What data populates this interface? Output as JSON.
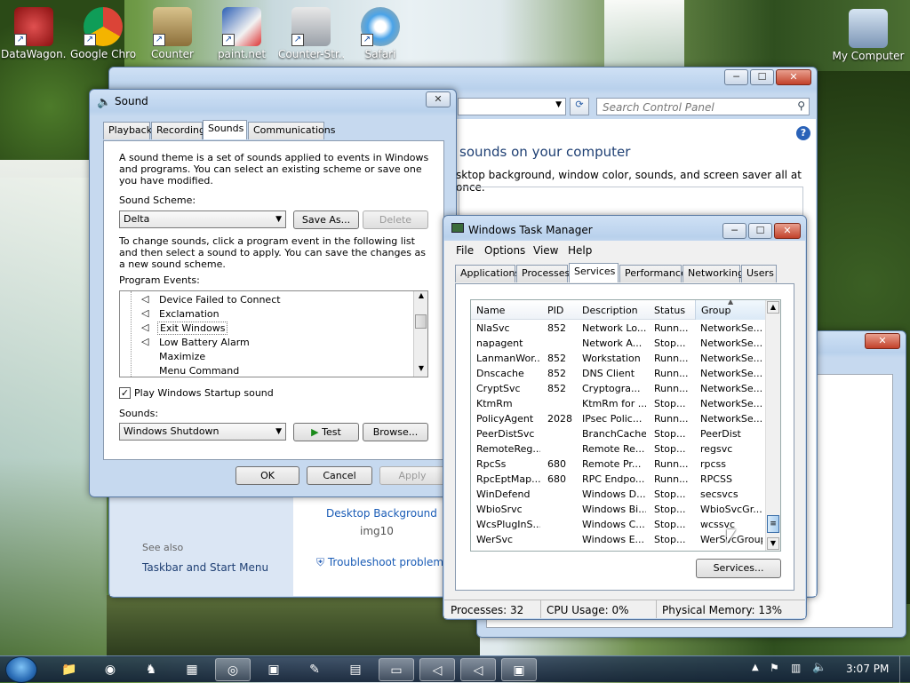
{
  "desktop": {
    "icons": [
      {
        "label": "DataWagon...",
        "icon": "datawagon-icon"
      },
      {
        "label": "Google Chro",
        "icon": "chrome-icon"
      },
      {
        "label": "Counter",
        "icon": "counter-icon"
      },
      {
        "label": "paint.net",
        "icon": "paintnet-icon"
      },
      {
        "label": "Counter-Str...",
        "icon": "counter-strike-icon"
      },
      {
        "label": "Safari",
        "icon": "safari-icon"
      },
      {
        "label": "My Computer",
        "icon": "computer-icon"
      }
    ]
  },
  "control_panel": {
    "search_placeholder": "Search Control Panel",
    "heading": "sounds on your computer",
    "subheading": "sktop background, window color, sounds, and screen saver all at once.",
    "desktop_background_link": "Desktop Background",
    "image_name": "img10",
    "see_also": "See also",
    "taskbar_link": "Taskbar and Start Menu",
    "troubleshoot_link": "Troubleshoot problems"
  },
  "sound": {
    "title": "Sound",
    "tabs": [
      "Playback",
      "Recording",
      "Sounds",
      "Communications"
    ],
    "active_tab": "Sounds",
    "intro": "A sound theme is a set of sounds applied to events in Windows and programs.  You can select an existing scheme or save one you have modified.",
    "scheme_label": "Sound Scheme:",
    "scheme_value": "Delta",
    "save_as": "Save As...",
    "delete": "Delete",
    "instructions": "To change sounds, click a program event in the following list and then select a sound to apply.  You can save the changes as a new sound scheme.",
    "events_label": "Program Events:",
    "events": [
      {
        "label": "Device Failed to Connect",
        "has_sound": true
      },
      {
        "label": "Exclamation",
        "has_sound": true
      },
      {
        "label": "Exit Windows",
        "has_sound": true
      },
      {
        "label": "Low Battery Alarm",
        "has_sound": true
      },
      {
        "label": "Maximize",
        "has_sound": false
      },
      {
        "label": "Menu Command",
        "has_sound": false
      }
    ],
    "selected_event": "Exit Windows",
    "startup_checkbox": "Play Windows Startup sound",
    "sounds_label": "Sounds:",
    "sound_value": "Windows Shutdown",
    "test": "Test",
    "browse": "Browse...",
    "ok": "OK",
    "cancel": "Cancel",
    "apply": "Apply"
  },
  "task_manager": {
    "title": "Windows Task Manager",
    "menu": [
      "File",
      "Options",
      "View",
      "Help"
    ],
    "tabs": [
      "Applications",
      "Processes",
      "Services",
      "Performance",
      "Networking",
      "Users"
    ],
    "active_tab": "Services",
    "columns": [
      "Name",
      "PID",
      "Description",
      "Status",
      "Group"
    ],
    "rows": [
      [
        "NlaSvc",
        "852",
        "Network Lo...",
        "Runn...",
        "NetworkSe..."
      ],
      [
        "napagent",
        "",
        "Network A...",
        "Stop...",
        "NetworkSe..."
      ],
      [
        "LanmanWor...",
        "852",
        "Workstation",
        "Runn...",
        "NetworkSe..."
      ],
      [
        "Dnscache",
        "852",
        "DNS Client",
        "Runn...",
        "NetworkSe..."
      ],
      [
        "CryptSvc",
        "852",
        "Cryptogra...",
        "Runn...",
        "NetworkSe..."
      ],
      [
        "KtmRm",
        "",
        "KtmRm for ...",
        "Stop...",
        "NetworkSe..."
      ],
      [
        "PolicyAgent",
        "2028",
        "IPsec Polic...",
        "Runn...",
        "NetworkSe..."
      ],
      [
        "PeerDistSvc",
        "",
        "BranchCache",
        "Stop...",
        "PeerDist"
      ],
      [
        "RemoteReg...",
        "",
        "Remote Re...",
        "Stop...",
        "regsvc"
      ],
      [
        "RpcSs",
        "680",
        "Remote Pr...",
        "Runn...",
        "rpcss"
      ],
      [
        "RpcEptMap...",
        "680",
        "RPC Endpo...",
        "Runn...",
        "RPCSS"
      ],
      [
        "WinDefend",
        "",
        "Windows D...",
        "Stop...",
        "secsvcs"
      ],
      [
        "WbioSrvc",
        "",
        "Windows Bi...",
        "Stop...",
        "WbioSvcGr..."
      ],
      [
        "WcsPlugInS...",
        "",
        "Windows C...",
        "Stop...",
        "wcssvc"
      ],
      [
        "WerSvc",
        "",
        "Windows E...",
        "Stop...",
        "WerSvcGroup"
      ]
    ],
    "services_button": "Services...",
    "status": {
      "processes": "Processes: 32",
      "cpu": "CPU Usage: 0%",
      "memory": "Physical Memory: 13%"
    }
  },
  "taskbar": {
    "items": [
      "explorer-icon",
      "chrome-icon",
      "counter-strike-icon",
      "control-panel-icon",
      "safari-icon",
      "counter-icon",
      "paint-icon",
      "notepad-icon",
      "display-icon",
      "speaker-icon",
      "speaker-icon",
      "task-manager-icon"
    ],
    "clock": "3:07 PM"
  }
}
